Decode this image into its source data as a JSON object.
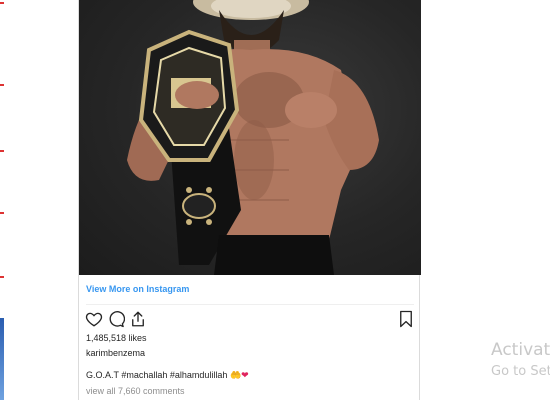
{
  "post": {
    "view_more_label": "View More on Instagram",
    "likes": "1,485,518 likes",
    "username": "karimbenzema",
    "caption": "G.O.A.T #machallah #alhamdulillah",
    "caption_emojis": "🤲❤",
    "comments_link": "view all 7,660 comments"
  },
  "icons": {
    "like": "heart-outline-icon",
    "comment": "speech-bubble-icon",
    "share": "share-upload-icon",
    "save": "bookmark-icon"
  },
  "watermark": {
    "line1": "Activat",
    "line2": "Go to Set"
  },
  "colors": {
    "link": "#3897f0",
    "text": "#262626",
    "muted": "#8e8e8e",
    "photo_bg": "#262626"
  }
}
